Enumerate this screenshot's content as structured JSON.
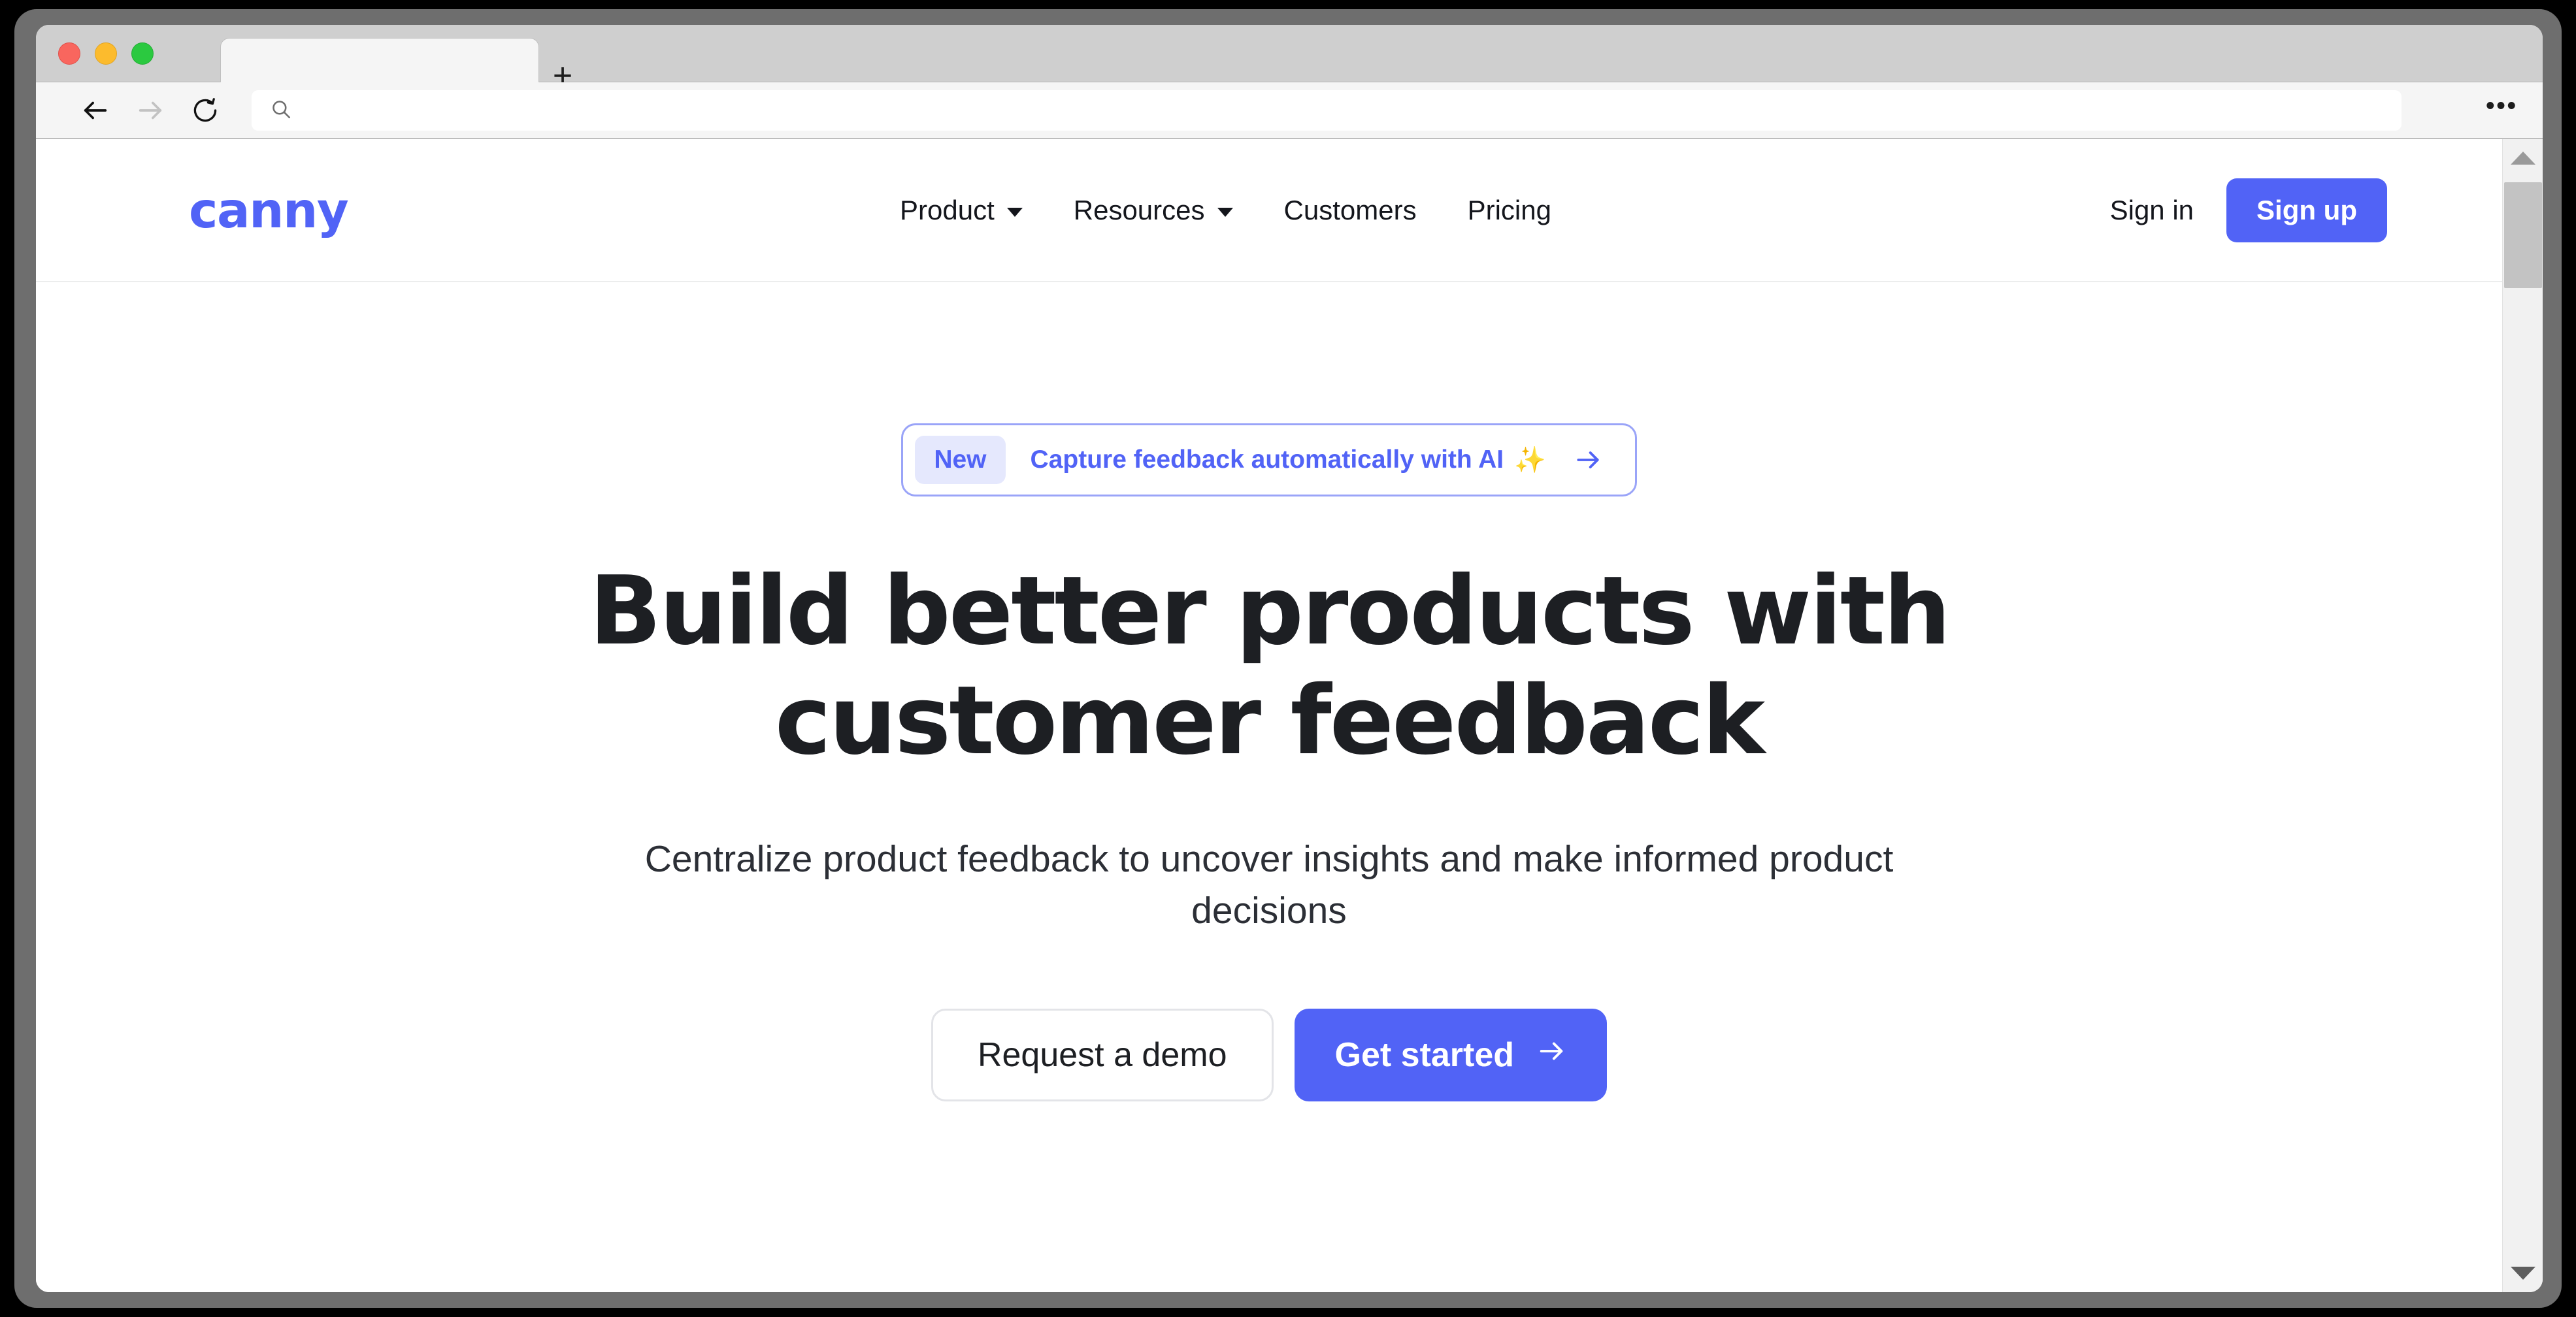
{
  "window": {
    "traffic_lights": [
      "close",
      "minimize",
      "maximize"
    ],
    "tab": {
      "title": "",
      "new_tab_label": "+"
    },
    "toolbar": {
      "back_icon": "arrow-left-icon",
      "forward_icon": "arrow-right-icon",
      "reload_icon": "reload-icon",
      "search_icon": "search-icon",
      "address_value": "",
      "address_placeholder": "",
      "menu_label": "•••"
    },
    "scrollbar": {
      "up_label": "▲",
      "down_label": "▼"
    }
  },
  "site": {
    "logo": "canny",
    "nav": [
      {
        "label": "Product",
        "has_dropdown": true
      },
      {
        "label": "Resources",
        "has_dropdown": true
      },
      {
        "label": "Customers",
        "has_dropdown": false
      },
      {
        "label": "Pricing",
        "has_dropdown": false
      }
    ],
    "actions": {
      "signin_label": "Sign in",
      "signup_label": "Sign up"
    }
  },
  "hero": {
    "announcement": {
      "badge": "New",
      "text": "Capture feedback automatically with AI",
      "sparkle": "✨",
      "arrow_icon": "arrow-right-icon"
    },
    "headline": "Build better products with customer feedback",
    "subheadline": "Centralize product feedback to uncover insights and make informed product decisions",
    "cta_secondary": "Request a demo",
    "cta_primary": "Get started",
    "cta_primary_arrow": "→"
  },
  "colors": {
    "brand_indigo": "#5163F6",
    "badge_bg": "#E5E8FD",
    "pill_border": "#9AA4F8",
    "sparkle_gold": "#F5B841",
    "text_dark": "#1D1F23",
    "window_frame": "#6E6E6E"
  }
}
